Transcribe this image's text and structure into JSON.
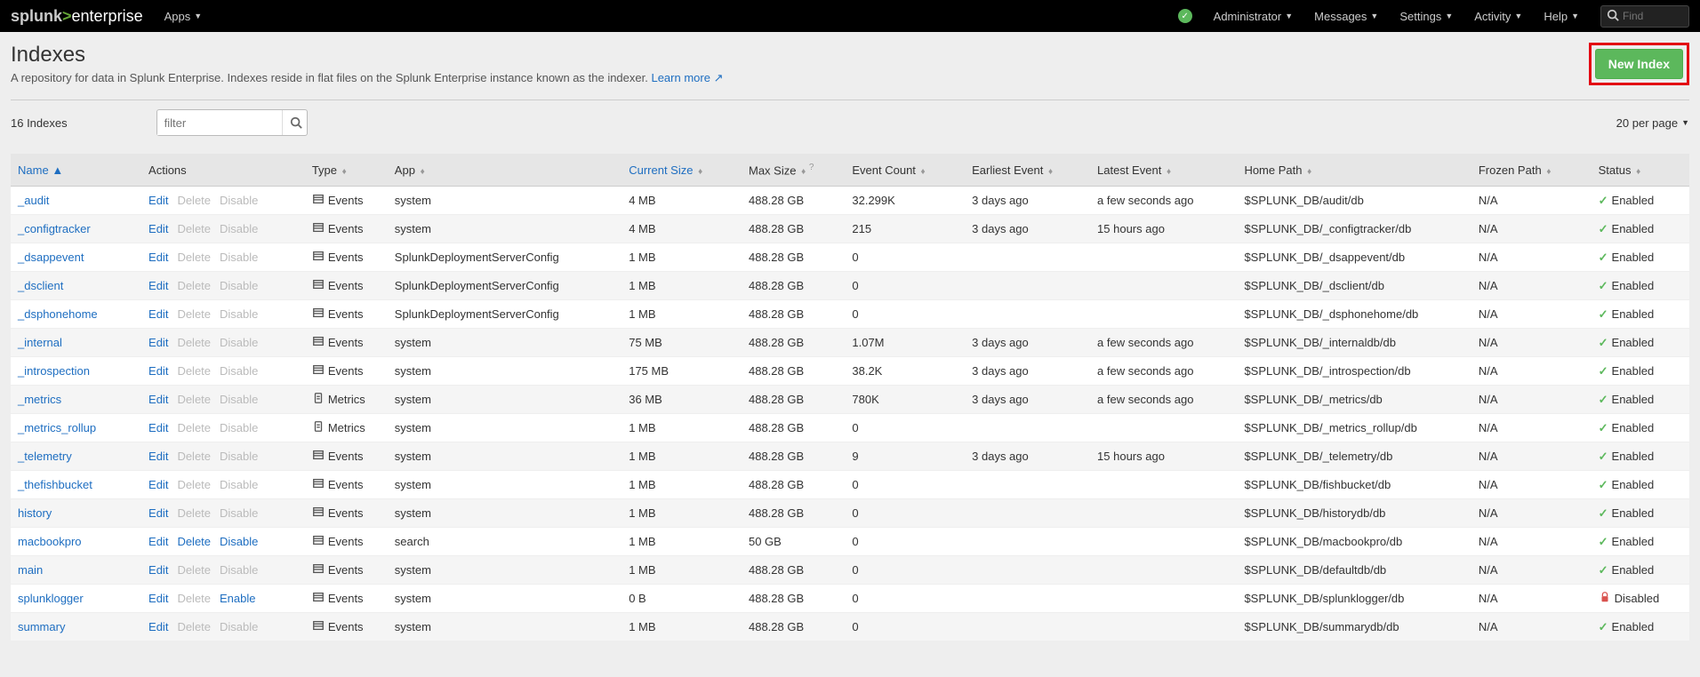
{
  "topbar": {
    "logo_prefix": "splunk",
    "logo_gt": ">",
    "logo_suffix": "enterprise",
    "apps": "Apps",
    "admin": "Administrator",
    "messages": "Messages",
    "settings": "Settings",
    "activity": "Activity",
    "help": "Help",
    "find_placeholder": "Find"
  },
  "header": {
    "title": "Indexes",
    "desc": "A repository for data in Splunk Enterprise. Indexes reside in flat files on the Splunk Enterprise instance known as the indexer. ",
    "learn_more": "Learn more",
    "new_index": "New Index"
  },
  "toolbar": {
    "count": "16 Indexes",
    "filter_placeholder": "filter",
    "per_page": "20 per page"
  },
  "columns": {
    "name": "Name",
    "actions": "Actions",
    "type": "Type",
    "app": "App",
    "current_size": "Current Size",
    "max_size": "Max Size",
    "event_count": "Event Count",
    "earliest": "Earliest Event",
    "latest": "Latest Event",
    "home_path": "Home Path",
    "frozen_path": "Frozen Path",
    "status": "Status"
  },
  "labels": {
    "edit": "Edit",
    "delete": "Delete",
    "disable": "Disable",
    "enable": "Enable",
    "events": "Events",
    "metrics": "Metrics",
    "enabled": "Enabled",
    "disabled": "Disabled"
  },
  "rows": [
    {
      "name": "_audit",
      "delete_enabled": false,
      "toggle_enabled": false,
      "toggle_label": "disable",
      "type": "events",
      "app": "system",
      "cur": "4 MB",
      "max": "488.28 GB",
      "count": "32.299K",
      "earliest": "3 days ago",
      "latest": "a few seconds ago",
      "home": "$SPLUNK_DB/audit/db",
      "frozen": "N/A",
      "status": "enabled"
    },
    {
      "name": "_configtracker",
      "delete_enabled": false,
      "toggle_enabled": false,
      "toggle_label": "disable",
      "type": "events",
      "app": "system",
      "cur": "4 MB",
      "max": "488.28 GB",
      "count": "215",
      "earliest": "3 days ago",
      "latest": "15 hours ago",
      "home": "$SPLUNK_DB/_configtracker/db",
      "frozen": "N/A",
      "status": "enabled"
    },
    {
      "name": "_dsappevent",
      "delete_enabled": false,
      "toggle_enabled": false,
      "toggle_label": "disable",
      "type": "events",
      "app": "SplunkDeploymentServerConfig",
      "cur": "1 MB",
      "max": "488.28 GB",
      "count": "0",
      "earliest": "",
      "latest": "",
      "home": "$SPLUNK_DB/_dsappevent/db",
      "frozen": "N/A",
      "status": "enabled"
    },
    {
      "name": "_dsclient",
      "delete_enabled": false,
      "toggle_enabled": false,
      "toggle_label": "disable",
      "type": "events",
      "app": "SplunkDeploymentServerConfig",
      "cur": "1 MB",
      "max": "488.28 GB",
      "count": "0",
      "earliest": "",
      "latest": "",
      "home": "$SPLUNK_DB/_dsclient/db",
      "frozen": "N/A",
      "status": "enabled"
    },
    {
      "name": "_dsphonehome",
      "delete_enabled": false,
      "toggle_enabled": false,
      "toggle_label": "disable",
      "type": "events",
      "app": "SplunkDeploymentServerConfig",
      "cur": "1 MB",
      "max": "488.28 GB",
      "count": "0",
      "earliest": "",
      "latest": "",
      "home": "$SPLUNK_DB/_dsphonehome/db",
      "frozen": "N/A",
      "status": "enabled"
    },
    {
      "name": "_internal",
      "delete_enabled": false,
      "toggle_enabled": false,
      "toggle_label": "disable",
      "type": "events",
      "app": "system",
      "cur": "75 MB",
      "max": "488.28 GB",
      "count": "1.07M",
      "earliest": "3 days ago",
      "latest": "a few seconds ago",
      "home": "$SPLUNK_DB/_internaldb/db",
      "frozen": "N/A",
      "status": "enabled"
    },
    {
      "name": "_introspection",
      "delete_enabled": false,
      "toggle_enabled": false,
      "toggle_label": "disable",
      "type": "events",
      "app": "system",
      "cur": "175 MB",
      "max": "488.28 GB",
      "count": "38.2K",
      "earliest": "3 days ago",
      "latest": "a few seconds ago",
      "home": "$SPLUNK_DB/_introspection/db",
      "frozen": "N/A",
      "status": "enabled"
    },
    {
      "name": "_metrics",
      "delete_enabled": false,
      "toggle_enabled": false,
      "toggle_label": "disable",
      "type": "metrics",
      "app": "system",
      "cur": "36 MB",
      "max": "488.28 GB",
      "count": "780K",
      "earliest": "3 days ago",
      "latest": "a few seconds ago",
      "home": "$SPLUNK_DB/_metrics/db",
      "frozen": "N/A",
      "status": "enabled"
    },
    {
      "name": "_metrics_rollup",
      "delete_enabled": false,
      "toggle_enabled": false,
      "toggle_label": "disable",
      "type": "metrics",
      "app": "system",
      "cur": "1 MB",
      "max": "488.28 GB",
      "count": "0",
      "earliest": "",
      "latest": "",
      "home": "$SPLUNK_DB/_metrics_rollup/db",
      "frozen": "N/A",
      "status": "enabled"
    },
    {
      "name": "_telemetry",
      "delete_enabled": false,
      "toggle_enabled": false,
      "toggle_label": "disable",
      "type": "events",
      "app": "system",
      "cur": "1 MB",
      "max": "488.28 GB",
      "count": "9",
      "earliest": "3 days ago",
      "latest": "15 hours ago",
      "home": "$SPLUNK_DB/_telemetry/db",
      "frozen": "N/A",
      "status": "enabled"
    },
    {
      "name": "_thefishbucket",
      "delete_enabled": false,
      "toggle_enabled": false,
      "toggle_label": "disable",
      "type": "events",
      "app": "system",
      "cur": "1 MB",
      "max": "488.28 GB",
      "count": "0",
      "earliest": "",
      "latest": "",
      "home": "$SPLUNK_DB/fishbucket/db",
      "frozen": "N/A",
      "status": "enabled"
    },
    {
      "name": "history",
      "delete_enabled": false,
      "toggle_enabled": false,
      "toggle_label": "disable",
      "type": "events",
      "app": "system",
      "cur": "1 MB",
      "max": "488.28 GB",
      "count": "0",
      "earliest": "",
      "latest": "",
      "home": "$SPLUNK_DB/historydb/db",
      "frozen": "N/A",
      "status": "enabled"
    },
    {
      "name": "macbookpro",
      "delete_enabled": true,
      "toggle_enabled": true,
      "toggle_label": "disable",
      "type": "events",
      "app": "search",
      "cur": "1 MB",
      "max": "50 GB",
      "count": "0",
      "earliest": "",
      "latest": "",
      "home": "$SPLUNK_DB/macbookpro/db",
      "frozen": "N/A",
      "status": "enabled"
    },
    {
      "name": "main",
      "delete_enabled": false,
      "toggle_enabled": false,
      "toggle_label": "disable",
      "type": "events",
      "app": "system",
      "cur": "1 MB",
      "max": "488.28 GB",
      "count": "0",
      "earliest": "",
      "latest": "",
      "home": "$SPLUNK_DB/defaultdb/db",
      "frozen": "N/A",
      "status": "enabled"
    },
    {
      "name": "splunklogger",
      "delete_enabled": false,
      "toggle_enabled": true,
      "toggle_label": "enable",
      "type": "events",
      "app": "system",
      "cur": "0 B",
      "max": "488.28 GB",
      "count": "0",
      "earliest": "",
      "latest": "",
      "home": "$SPLUNK_DB/splunklogger/db",
      "frozen": "N/A",
      "status": "disabled"
    },
    {
      "name": "summary",
      "delete_enabled": false,
      "toggle_enabled": false,
      "toggle_label": "disable",
      "type": "events",
      "app": "system",
      "cur": "1 MB",
      "max": "488.28 GB",
      "count": "0",
      "earliest": "",
      "latest": "",
      "home": "$SPLUNK_DB/summarydb/db",
      "frozen": "N/A",
      "status": "enabled"
    }
  ]
}
